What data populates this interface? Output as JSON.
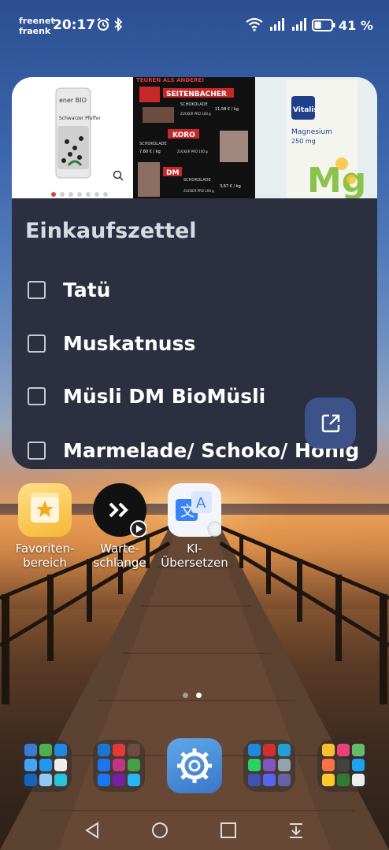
{
  "status_bar": {
    "carrier_line1": "freenet",
    "carrier_line2": "fraenk",
    "time": "20:17",
    "battery_percent": "41 %",
    "battery_level": 0.41,
    "icons": [
      "alarm-icon",
      "bluetooth-icon",
      "wifi-icon",
      "signal-icon",
      "signal-icon",
      "battery-icon"
    ]
  },
  "widget": {
    "title": "Einkaufszettel",
    "carousel": {
      "slide_count": 7,
      "active_index": 0,
      "slide1": {
        "brand": "ener BIO",
        "product": "Schwarzer Pfeffer"
      },
      "slide2": {
        "header": "TEUREN ALS ANDERE!",
        "rows": [
          {
            "name": "SEITENBACHER",
            "tag": "SCHOKOLADE",
            "price": "11,58 € / kg",
            "sugar": "ZUCKER PRO 100 g"
          },
          {
            "name": "KORO",
            "tag": "SCHOKOLADE",
            "price": "7,60 € / kg",
            "sugar": "ZUCKER PRO 100 g"
          },
          {
            "name": "DM",
            "tag": "SCHOKOLADE",
            "price": "3,67 € / kg",
            "sugar": "ZUCKER PRO 100 g"
          }
        ]
      },
      "slide3": {
        "brand": "Vitalis",
        "product": "Magnesium",
        "dose": "250 mg",
        "symbol": "Mg"
      }
    },
    "items": [
      {
        "label": "Tatü",
        "checked": false
      },
      {
        "label": "Muskatnuss",
        "checked": false
      },
      {
        "label": "Müsli DM BioMüsli",
        "checked": false
      },
      {
        "label": "Marmelade/ Schoko/ Honig",
        "checked": false
      }
    ]
  },
  "apps": [
    {
      "label": "Favoriten-\nbereich",
      "icon": "star-folder-icon"
    },
    {
      "label": "Warte-\nschlange",
      "icon": "queue-icon"
    },
    {
      "label": "KI-\nÜbersetzen",
      "icon": "translate-icon"
    }
  ],
  "pages": {
    "count": 2,
    "active": 1
  },
  "dock": {
    "folder1": [
      "#3a7bd5",
      "#4caf50",
      "#1e88e5",
      "#42a5f5",
      "#2196f3",
      "#eeeeee",
      "#1565c0",
      "#90caf9",
      "#26c6da"
    ],
    "folder2": [
      "#1976d2",
      "#e53935",
      "#6d4c41",
      "#1877f2",
      "#c13584",
      "#43a047",
      "#1877f2",
      "#7b1fa2",
      "#29b6f6"
    ],
    "folder3": [
      "#1e88e5",
      "#d32f2f",
      "#229ed9",
      "#25d366",
      "#7e57c2",
      "#90a4ae",
      "#3f51b5",
      "#5865f2",
      "#6264a7"
    ],
    "folder4": [
      "#fbc02d",
      "#ec407a",
      "#66bb6a",
      "#ff7043",
      "#424242",
      "#1da1f2",
      "#ffca28",
      "#2e7d32",
      "#eeeeee"
    ],
    "settings_icon": "settings-gear-icon"
  },
  "nav": [
    "back-icon",
    "home-icon",
    "recents-icon",
    "notification-pull-icon"
  ]
}
